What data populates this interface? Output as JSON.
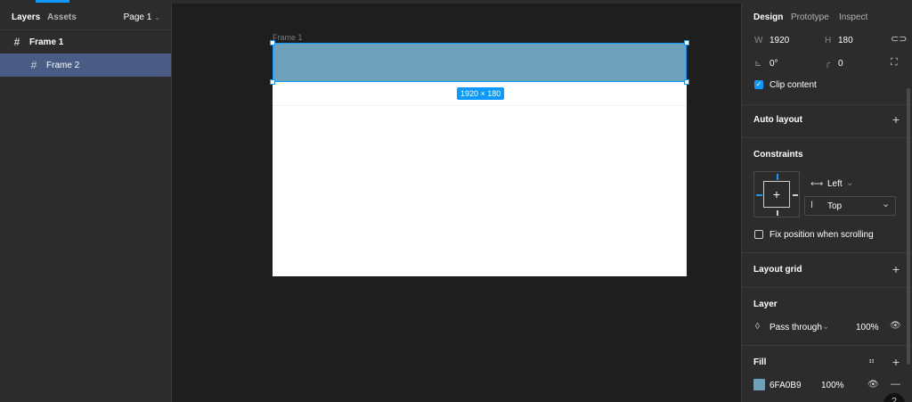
{
  "left_panel": {
    "tabs": {
      "layers": "Layers",
      "assets": "Assets"
    },
    "page_selector": {
      "label": "Page 1",
      "chevron": "⌄"
    },
    "layers": [
      {
        "icon": "frame-hash-icon",
        "glyph": "#",
        "name": "Frame 1"
      },
      {
        "icon": "frame-hash-icon",
        "glyph": "#",
        "name": "Frame 2",
        "selected": true
      }
    ]
  },
  "canvas": {
    "frame_label": "Frame 1",
    "size_badge": "1920 × 180",
    "frame1_color": "#ffffff",
    "frame2_color": "#6fa0b9",
    "selection_color": "#0d99ff"
  },
  "right_panel": {
    "tabs": {
      "design": "Design",
      "prototype": "Prototype",
      "inspect": "Inspect"
    },
    "dimensions": {
      "w_label": "W",
      "w_value": "1920",
      "h_label": "H",
      "h_value": "180",
      "rotation_label": "⊾",
      "rotation_value": "0°",
      "radius_label": "╭",
      "radius_value": "0"
    },
    "clip_content": {
      "label": "Clip content",
      "checked": true
    },
    "auto_layout": {
      "title": "Auto layout"
    },
    "constraints": {
      "title": "Constraints",
      "horizontal": "Left",
      "vertical": "Top",
      "fix_position_label": "Fix position when scrolling",
      "fix_position_checked": false
    },
    "layout_grid": {
      "title": "Layout grid"
    },
    "layer": {
      "title": "Layer",
      "blend_mode": "Pass through",
      "opacity": "100%"
    },
    "fill": {
      "title": "Fill",
      "hex": "6FA0B9",
      "opacity": "100%",
      "color": "#6fa0b9"
    },
    "icons": {
      "plus": "+",
      "minus": "—",
      "eye": "👁",
      "chevron": "⌄",
      "check": "✓",
      "help": "?"
    }
  }
}
